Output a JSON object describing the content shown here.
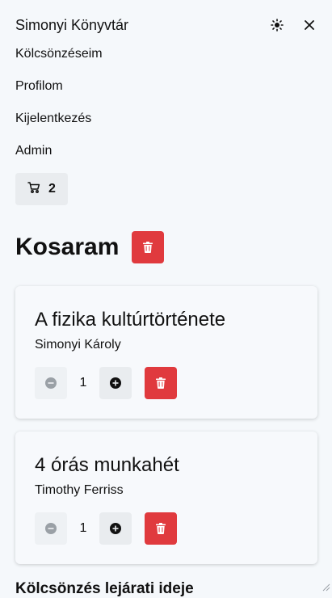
{
  "header": {
    "title": "Simonyi Könyvtár",
    "theme_icon": "sun-icon",
    "close_icon": "close-icon"
  },
  "nav": {
    "items": [
      {
        "label": "Kölcsönzéseim"
      },
      {
        "label": "Profilom"
      },
      {
        "label": "Kijelentkezés"
      },
      {
        "label": "Admin"
      }
    ]
  },
  "cart": {
    "icon": "cart-icon",
    "count": "2"
  },
  "page": {
    "title": "Kosaram"
  },
  "items": [
    {
      "title": "A fizika kultúrtörténete",
      "author": "Simonyi Károly",
      "quantity": "1"
    },
    {
      "title": "4 órás munkahét",
      "author": "Timothy Ferriss",
      "quantity": "1"
    }
  ],
  "section": {
    "title": "Kölcsönzés lejárati ideje"
  },
  "colors": {
    "danger": "#e03a3e",
    "button_bg": "#e9ecef",
    "background": "#f5f8fb"
  }
}
